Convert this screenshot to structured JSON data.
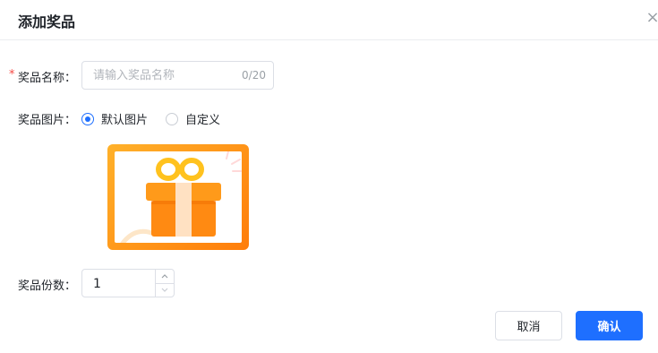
{
  "dialog": {
    "title": "添加奖品",
    "close_icon": "close-icon"
  },
  "form": {
    "prize_name": {
      "label": "奖品名称：",
      "required_mark": "*",
      "placeholder": "请输入奖品名称",
      "value": "",
      "char_count": "0/20"
    },
    "prize_image": {
      "label": "奖品图片：",
      "options": [
        {
          "label": "默认图片",
          "selected": true
        },
        {
          "label": "自定义",
          "selected": false
        }
      ],
      "image_icon": "gift-box-icon"
    },
    "prize_quantity": {
      "label": "奖品份数：",
      "value": "1"
    }
  },
  "footer": {
    "cancel_label": "取消",
    "confirm_label": "确认"
  },
  "colors": {
    "primary": "#1e6fff",
    "required": "#f54a45",
    "gift_orange": "#ff8a12",
    "gift_yellow": "#ffbf1f"
  }
}
